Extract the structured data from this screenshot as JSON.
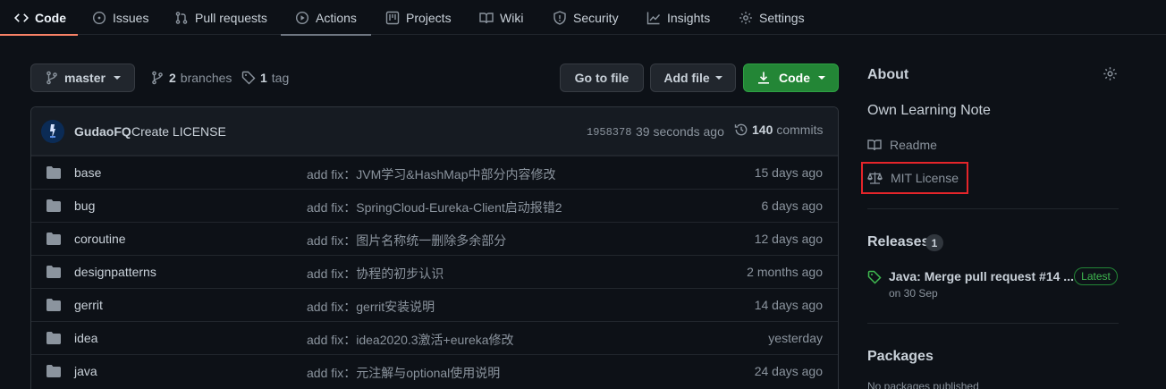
{
  "nav": {
    "tabs": [
      {
        "label": "Code",
        "icon": "code-icon"
      },
      {
        "label": "Issues",
        "icon": "issue-icon"
      },
      {
        "label": "Pull requests",
        "icon": "pull-request-icon"
      },
      {
        "label": "Actions",
        "icon": "play-icon"
      },
      {
        "label": "Projects",
        "icon": "project-icon"
      },
      {
        "label": "Wiki",
        "icon": "book-icon"
      },
      {
        "label": "Security",
        "icon": "shield-icon"
      },
      {
        "label": "Insights",
        "icon": "graph-icon"
      },
      {
        "label": "Settings",
        "icon": "gear-icon"
      }
    ]
  },
  "toolbar": {
    "branch": "master",
    "branches_count": "2",
    "branches_label": "branches",
    "tags_count": "1",
    "tags_label": "tag",
    "go_to_file": "Go to file",
    "add_file": "Add file",
    "code": "Code"
  },
  "commit": {
    "author": "GudaoFQ",
    "message": "Create LICENSE",
    "sha": "1958378",
    "time": "39 seconds ago",
    "count": "140",
    "count_label": "commits"
  },
  "files": [
    {
      "name": "base",
      "message": "add fix：JVM学习&HashMap中部分内容修改",
      "age": "15 days ago"
    },
    {
      "name": "bug",
      "message": "add fix：SpringCloud-Eureka-Client启动报错2",
      "age": "6 days ago"
    },
    {
      "name": "coroutine",
      "message": "add fix：图片名称统一删除多余部分",
      "age": "12 days ago"
    },
    {
      "name": "designpatterns",
      "message": "add fix：协程的初步认识",
      "age": "2 months ago"
    },
    {
      "name": "gerrit",
      "message": "add fix：gerrit安装说明",
      "age": "14 days ago"
    },
    {
      "name": "idea",
      "message": "add fix：idea2020.3激活+eureka修改",
      "age": "yesterday"
    },
    {
      "name": "java",
      "message": "add fix：元注解与optional使用说明",
      "age": "24 days ago"
    }
  ],
  "sidebar": {
    "about_title": "About",
    "description": "Own Learning Note",
    "readme": "Readme",
    "license": "MIT License",
    "releases_title": "Releases",
    "releases_count": "1",
    "release_name": "Java: Merge pull request #14 ...",
    "release_badge": "Latest",
    "release_date": "on 30 Sep",
    "packages_title": "Packages",
    "packages_empty": "No packages published"
  },
  "colors": {
    "background": "#0d1117",
    "accent_tab": "#f78166",
    "green_button": "#238636",
    "highlight_box": "#e5252a",
    "latest_badge": "#3fb950"
  }
}
